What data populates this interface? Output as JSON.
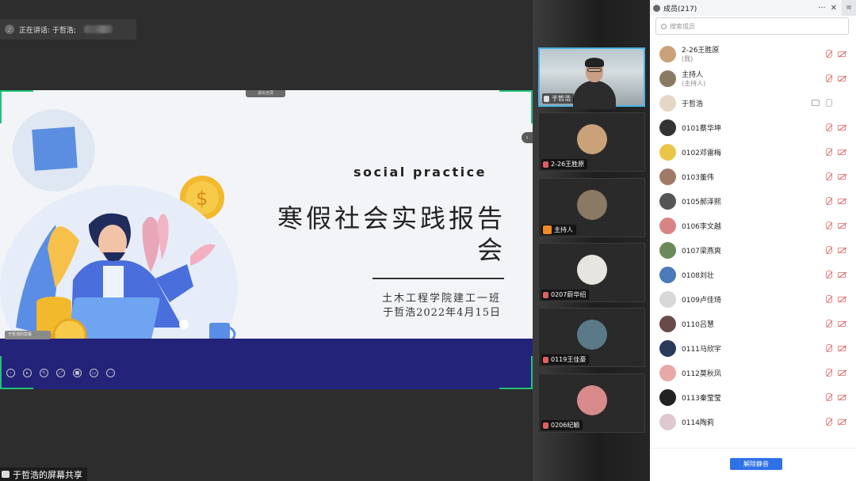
{
  "share": {
    "speaking_label": "正在讲话: 于哲浩;",
    "share_tag": "退出全屏",
    "mini_badge": "于哲浩的屏幕",
    "status_label": "于哲浩的屏幕共享"
  },
  "slide": {
    "english_title": "social practice",
    "title": "寒假社会实践报告会",
    "school": "土木工程学院建工一班",
    "date": "于哲浩2022年4月15日"
  },
  "toolbar": {
    "icons": [
      "back-icon",
      "play-icon",
      "pen-icon",
      "expand-icon",
      "video-icon",
      "chat-icon",
      "more-icon"
    ]
  },
  "videos": {
    "tiles": [
      {
        "name": "于哲浩",
        "type": "camera",
        "mic": "on"
      },
      {
        "name": "2-26王胜原",
        "type": "avatar",
        "color": "#c9a27a",
        "mic": "muted"
      },
      {
        "name": "主持人",
        "type": "avatar",
        "color": "#8a7a64",
        "mic": "host"
      },
      {
        "name": "0207蔚华绍",
        "type": "avatar",
        "color": "#e8e4e0",
        "mic": "muted"
      },
      {
        "name": "0119王佳豪",
        "type": "avatar",
        "color": "#5b7a88",
        "mic": "muted"
      },
      {
        "name": "0206纪颖",
        "type": "avatar",
        "color": "#d98a8a",
        "mic": "muted"
      }
    ]
  },
  "panel": {
    "title": "成员(217)",
    "more": "···",
    "close": "✕",
    "menu": "≡",
    "search_placeholder": "搜索成员",
    "unmute_all": "解除静音",
    "members": [
      {
        "name": "2-26王胜原",
        "sub": "(我)",
        "color": "#c9a27a",
        "muted": true
      },
      {
        "name": "主持人",
        "sub": "(主持人)",
        "color": "#8a7a64",
        "muted": true
      },
      {
        "name": "于哲浩",
        "sub": "",
        "color": "#e6d6c6",
        "muted": false
      },
      {
        "name": "0101蔡华坤",
        "sub": "",
        "color": "#333333",
        "muted": true
      },
      {
        "name": "0102邓雷梅",
        "sub": "",
        "color": "#e9c64a",
        "muted": true
      },
      {
        "name": "0103董伟",
        "sub": "",
        "color": "#a07a68",
        "muted": true
      },
      {
        "name": "0105郝泽熙",
        "sub": "",
        "color": "#555555",
        "muted": true
      },
      {
        "name": "0106李文越",
        "sub": "",
        "color": "#d98484",
        "muted": true
      },
      {
        "name": "0107梁燕爽",
        "sub": "",
        "color": "#6a8a5a",
        "muted": true
      },
      {
        "name": "0108刘壮",
        "sub": "",
        "color": "#4a7ab8",
        "muted": true
      },
      {
        "name": "0109卢佳琦",
        "sub": "",
        "color": "#d8d8d8",
        "muted": true
      },
      {
        "name": "0110吕慧",
        "sub": "",
        "color": "#6a4a48",
        "muted": true
      },
      {
        "name": "0111马欣宇",
        "sub": "",
        "color": "#2a3a5a",
        "muted": true
      },
      {
        "name": "0112莫秋凤",
        "sub": "",
        "color": "#e8a8a8",
        "muted": true
      },
      {
        "name": "0113秦莹莹",
        "sub": "",
        "color": "#222222",
        "muted": true
      },
      {
        "name": "0114陶莉",
        "sub": "",
        "color": "#e0c8d0",
        "muted": true
      }
    ]
  }
}
